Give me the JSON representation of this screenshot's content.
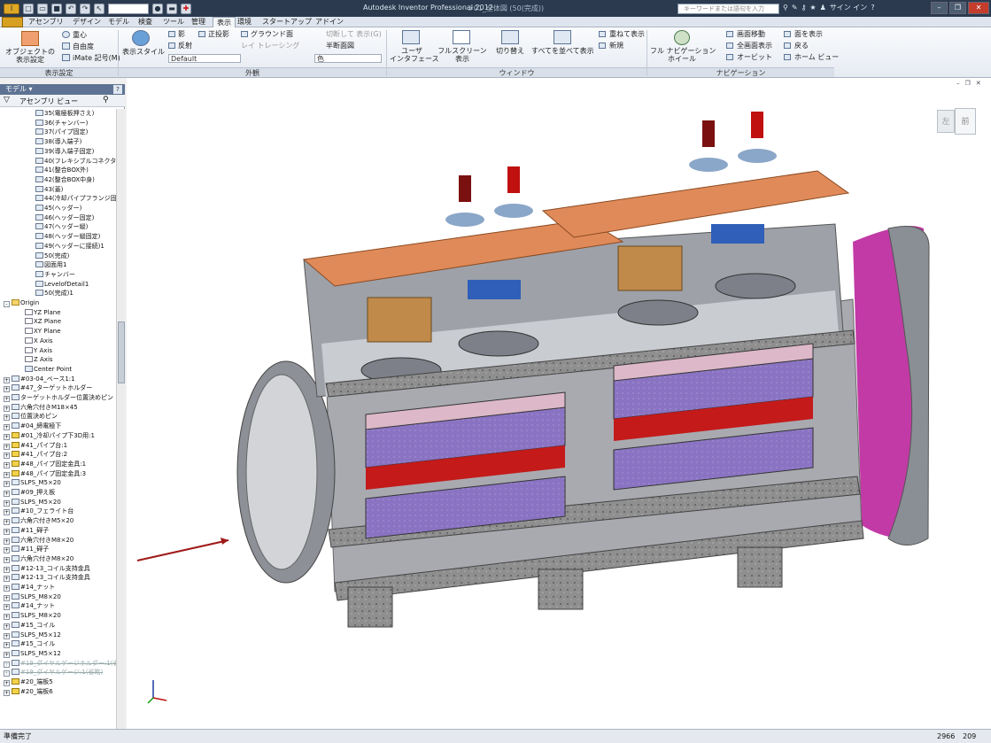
{
  "app": {
    "title": "Autodesk Inventor Professional 2012",
    "document": "#01_全体図 (50(完成))"
  },
  "search": {
    "placeholder": "キーワードまたは語句を入力"
  },
  "titlebar": {
    "signin": "サイン イン"
  },
  "tabs": [
    "アセンブリ",
    "デザイン",
    "モデル",
    "検査",
    "ツール",
    "管理",
    "表示",
    "環境",
    "スタートアップ",
    "アドイン"
  ],
  "active_tab": "表示",
  "ribbon": {
    "visibility": {
      "label": "表示設定",
      "obj_vis": "オブジェクトの\n表示設定",
      "cog": "重心",
      "dof": "自由度",
      "imate": "iMate 記号(M)"
    },
    "appearance": {
      "label": "外観",
      "visual_style": "表示スタイル",
      "shadows": "影",
      "ortho": "正投影",
      "ground": "グラウンド面",
      "reflect": "反射",
      "raytrace": "レイ トレーシング",
      "cutaway": "切断して 表示(G)",
      "half_section": "半断面図",
      "default_dd": "Default",
      "color_dd": "色"
    },
    "windows": {
      "label": "ウィンドウ",
      "ui": "ユーザ\nインタフェース",
      "fullscreen": "フルスクリーン\n表示",
      "switch": "切り替え",
      "arrange": "すべてを並べて表示",
      "cascade": "重ねて表示",
      "new": "新規"
    },
    "navigate": {
      "label": "ナビゲーション",
      "wheel": "フル ナビゲーション\nホイール",
      "pan": "画面移動",
      "zoom_all": "全画面表示",
      "orbit": "オービット",
      "look_at": "面を表示",
      "back": "戻る",
      "home": "ホーム ビュー"
    }
  },
  "browser": {
    "title": "モデル",
    "view": "アセンブリ ビュー"
  },
  "tree": [
    {
      "t": "35(電極板押さえ)",
      "l": 3,
      "i": "part"
    },
    {
      "t": "36(チャンバー)",
      "l": 3,
      "i": "part"
    },
    {
      "t": "37(パイプ固定)",
      "l": 3,
      "i": "part"
    },
    {
      "t": "38(導入端子)",
      "l": 3,
      "i": "part"
    },
    {
      "t": "39(導入端子固定)",
      "l": 3,
      "i": "part"
    },
    {
      "t": "40(フレキシブルコネクタ)",
      "l": 3,
      "i": "part"
    },
    {
      "t": "41(整合BOX外)",
      "l": 3,
      "i": "part"
    },
    {
      "t": "42(整合BOX中身)",
      "l": 3,
      "i": "part"
    },
    {
      "t": "43(蓋)",
      "l": 3,
      "i": "part"
    },
    {
      "t": "44(冷却パイプフランジ固定",
      "l": 3,
      "i": "part"
    },
    {
      "t": "45(ヘッダー)",
      "l": 3,
      "i": "part"
    },
    {
      "t": "46(ヘッダー固定)",
      "l": 3,
      "i": "part"
    },
    {
      "t": "47(ヘッダー縦)",
      "l": 3,
      "i": "part"
    },
    {
      "t": "48(ヘッダー縦固定)",
      "l": 3,
      "i": "part"
    },
    {
      "t": "49(ヘッダーに接続)1",
      "l": 3,
      "i": "part"
    },
    {
      "t": "50(完成)",
      "l": 3,
      "i": "check"
    },
    {
      "t": "図面用1",
      "l": 3,
      "i": "part"
    },
    {
      "t": "チャンバー",
      "l": 3,
      "i": "part"
    },
    {
      "t": "LevelofDetail1",
      "l": 3,
      "i": "part"
    },
    {
      "t": "50(完成)1",
      "l": 3,
      "i": "part"
    },
    {
      "t": "Origin",
      "l": 0,
      "i": "folder",
      "exp": "-"
    },
    {
      "t": "YZ Plane",
      "l": 2,
      "i": "plane"
    },
    {
      "t": "XZ Plane",
      "l": 2,
      "i": "plane"
    },
    {
      "t": "XY Plane",
      "l": 2,
      "i": "plane"
    },
    {
      "t": "X Axis",
      "l": 2,
      "i": "plane"
    },
    {
      "t": "Y Axis",
      "l": 2,
      "i": "plane"
    },
    {
      "t": "Z Axis",
      "l": 2,
      "i": "plane"
    },
    {
      "t": "Center Point",
      "l": 2,
      "i": "point"
    },
    {
      "t": "#03-04_ベース1:1",
      "l": 0,
      "i": "asm",
      "exp": "+"
    },
    {
      "t": "#47_ターゲットホルダー",
      "l": 0,
      "i": "asm",
      "exp": "+"
    },
    {
      "t": "ターゲットホルダー位置決めピン",
      "l": 0,
      "i": "asm",
      "exp": "+"
    },
    {
      "t": "六角穴付きM18×45",
      "l": 0,
      "i": "asm",
      "exp": "+"
    },
    {
      "t": "位置決めピン",
      "l": 0,
      "i": "asm",
      "exp": "+"
    },
    {
      "t": "#04_締電極下",
      "l": 0,
      "i": "asm",
      "exp": "+"
    },
    {
      "t": "#01_冷却パイプ下3D用:1",
      "l": 0,
      "i": "yellow",
      "exp": "+"
    },
    {
      "t": "#41_パイプ台:1",
      "l": 0,
      "i": "yellow",
      "exp": "+"
    },
    {
      "t": "#41_パイプ台:2",
      "l": 0,
      "i": "yellow",
      "exp": "+"
    },
    {
      "t": "#48_パイプ固定金具:1",
      "l": 0,
      "i": "yellow",
      "exp": "+"
    },
    {
      "t": "#48_パイプ固定金具:3",
      "l": 0,
      "i": "yellow",
      "exp": "+"
    },
    {
      "t": "SLPS_M5×20",
      "l": 0,
      "i": "asm",
      "exp": "+"
    },
    {
      "t": "#09_押え板",
      "l": 0,
      "i": "asm",
      "exp": "+"
    },
    {
      "t": "SLPS_M5×20",
      "l": 0,
      "i": "asm",
      "exp": "+"
    },
    {
      "t": "#10_フェライト台",
      "l": 0,
      "i": "asm",
      "exp": "+"
    },
    {
      "t": "六角穴付きM5×20",
      "l": 0,
      "i": "asm",
      "exp": "+"
    },
    {
      "t": "#11_碍子",
      "l": 0,
      "i": "asm",
      "exp": "+"
    },
    {
      "t": "六角穴付きM8×20",
      "l": 0,
      "i": "asm",
      "exp": "+"
    },
    {
      "t": "#11_碍子",
      "l": 0,
      "i": "asm",
      "exp": "+"
    },
    {
      "t": "六角穴付きM8×20",
      "l": 0,
      "i": "asm",
      "exp": "+"
    },
    {
      "t": "#12-13_コイル支持金具",
      "l": 0,
      "i": "asm",
      "exp": "+"
    },
    {
      "t": "#12-13_コイル支持金具",
      "l": 0,
      "i": "asm",
      "exp": "+"
    },
    {
      "t": "#14_ナット",
      "l": 0,
      "i": "asm",
      "exp": "+"
    },
    {
      "t": "SLPS_M8×20",
      "l": 0,
      "i": "asm",
      "exp": "+"
    },
    {
      "t": "#14_ナット",
      "l": 0,
      "i": "asm",
      "exp": "+"
    },
    {
      "t": "SLPS_M8×20",
      "l": 0,
      "i": "asm",
      "exp": "+"
    },
    {
      "t": "#15_コイル",
      "l": 0,
      "i": "asm",
      "exp": "+"
    },
    {
      "t": "SLPS_M5×12",
      "l": 0,
      "i": "asm",
      "exp": "+"
    },
    {
      "t": "#15_コイル",
      "l": 0,
      "i": "asm",
      "exp": "+"
    },
    {
      "t": "SLPS_M5×12",
      "l": 0,
      "i": "asm",
      "exp": "+"
    },
    {
      "t": "#19_ダイヤルゲージホルダー:1(省略)",
      "l": 0,
      "i": "asm",
      "exp": "+",
      "s": true
    },
    {
      "t": "#19_ダイヤルゲージ:1(省略)",
      "l": 0,
      "i": "asm",
      "exp": "+",
      "s": true
    },
    {
      "t": "#20_端板5",
      "l": 0,
      "i": "yellow",
      "exp": "+"
    },
    {
      "t": "#20_端板6",
      "l": 0,
      "i": "yellow",
      "exp": "+"
    }
  ],
  "viewcube": {
    "left": "左",
    "front": "前"
  },
  "status": {
    "text": "準備完了",
    "n1": "2966",
    "n2": "209"
  }
}
